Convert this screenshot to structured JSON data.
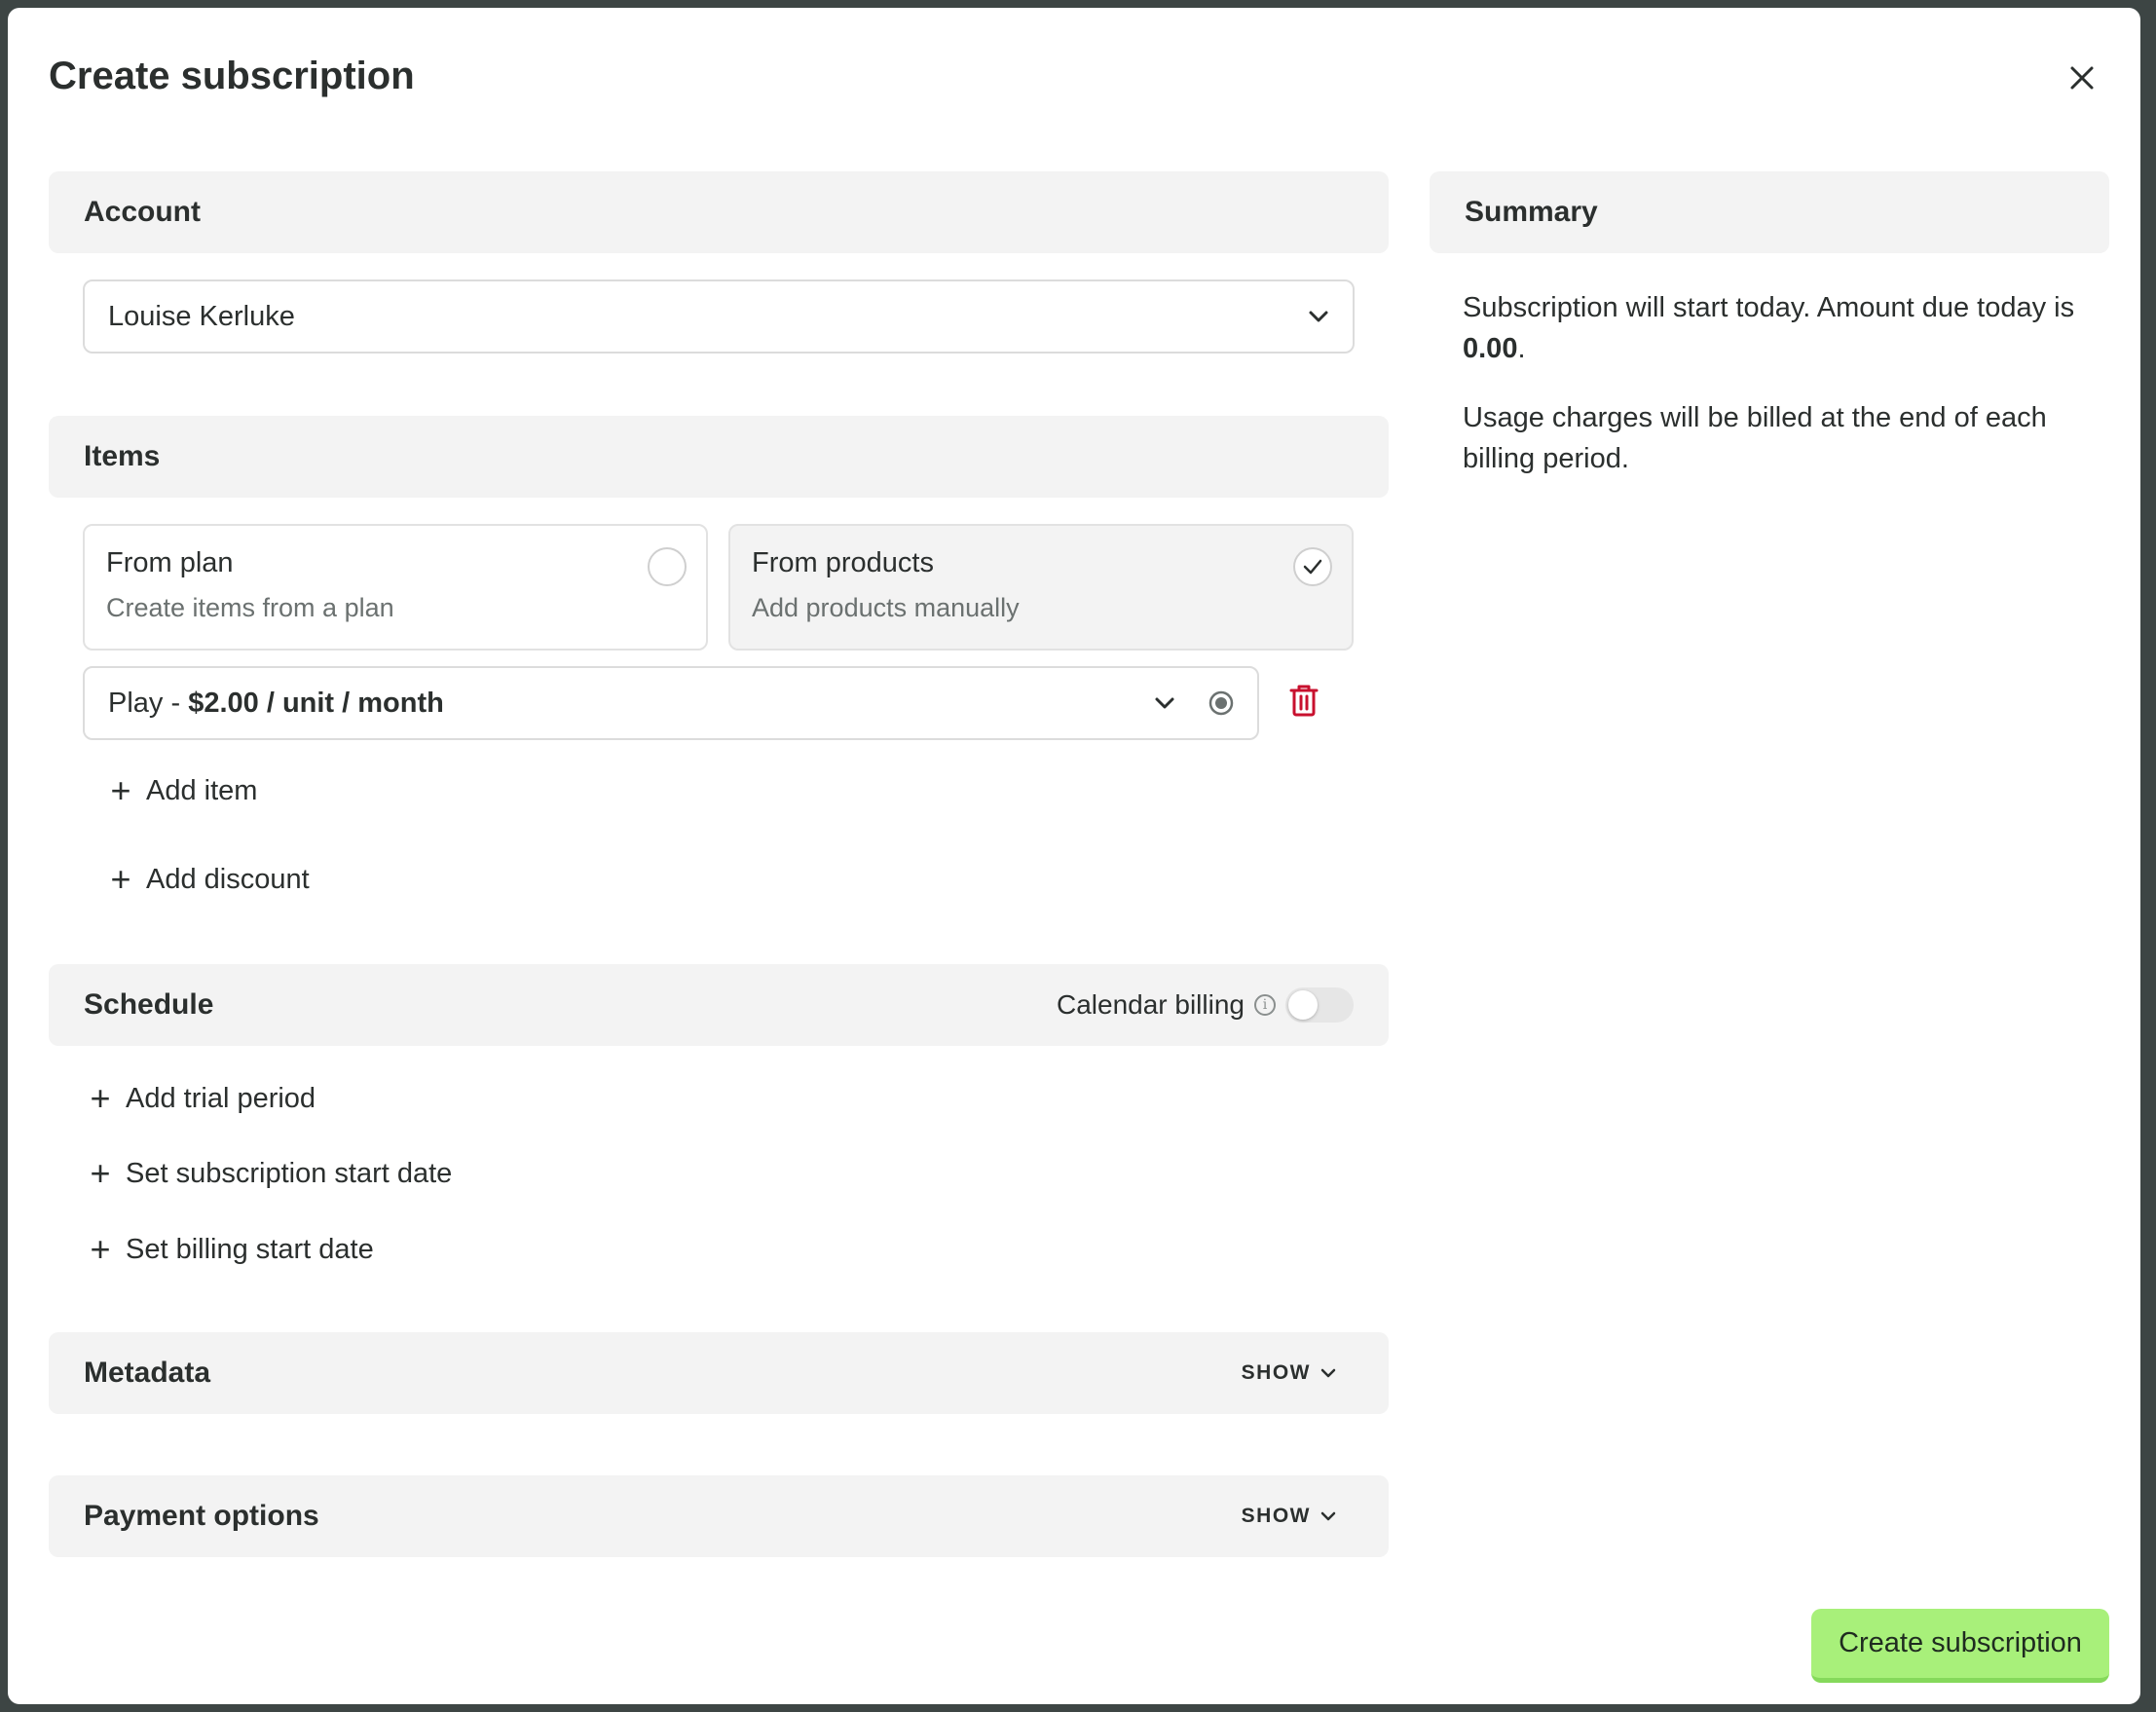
{
  "dialog": {
    "title": "Create subscription",
    "close_icon": "close-icon"
  },
  "account": {
    "section_title": "Account",
    "selected_account": "Louise Kerluke"
  },
  "items": {
    "section_title": "Items",
    "options": [
      {
        "title": "From plan",
        "subtitle": "Create items from a plan",
        "selected": false
      },
      {
        "title": "From products",
        "subtitle": "Add products manually",
        "selected": true
      }
    ],
    "line_item": {
      "name": "Play",
      "separator": " - ",
      "price": "$2.00 / unit / month"
    },
    "add_item_label": "Add item",
    "add_discount_label": "Add discount"
  },
  "schedule": {
    "section_title": "Schedule",
    "calendar_billing_label": "Calendar billing",
    "calendar_billing_enabled": false,
    "actions": [
      "Add trial period",
      "Set subscription start date",
      "Set billing start date"
    ]
  },
  "metadata": {
    "section_title": "Metadata",
    "toggle_label": "SHOW"
  },
  "payment_options": {
    "section_title": "Payment options",
    "toggle_label": "SHOW"
  },
  "summary": {
    "section_title": "Summary",
    "line1_prefix": "Subscription will start today. Amount due today is ",
    "amount_due": "0.00",
    "line1_suffix": ".",
    "line2": "Usage charges will be billed at the end of each billing period."
  },
  "footer": {
    "submit_label": "Create subscription"
  },
  "colors": {
    "primary_button": "#a8f07a",
    "delete_icon": "#c8102e",
    "section_bg": "#f3f3f3"
  }
}
